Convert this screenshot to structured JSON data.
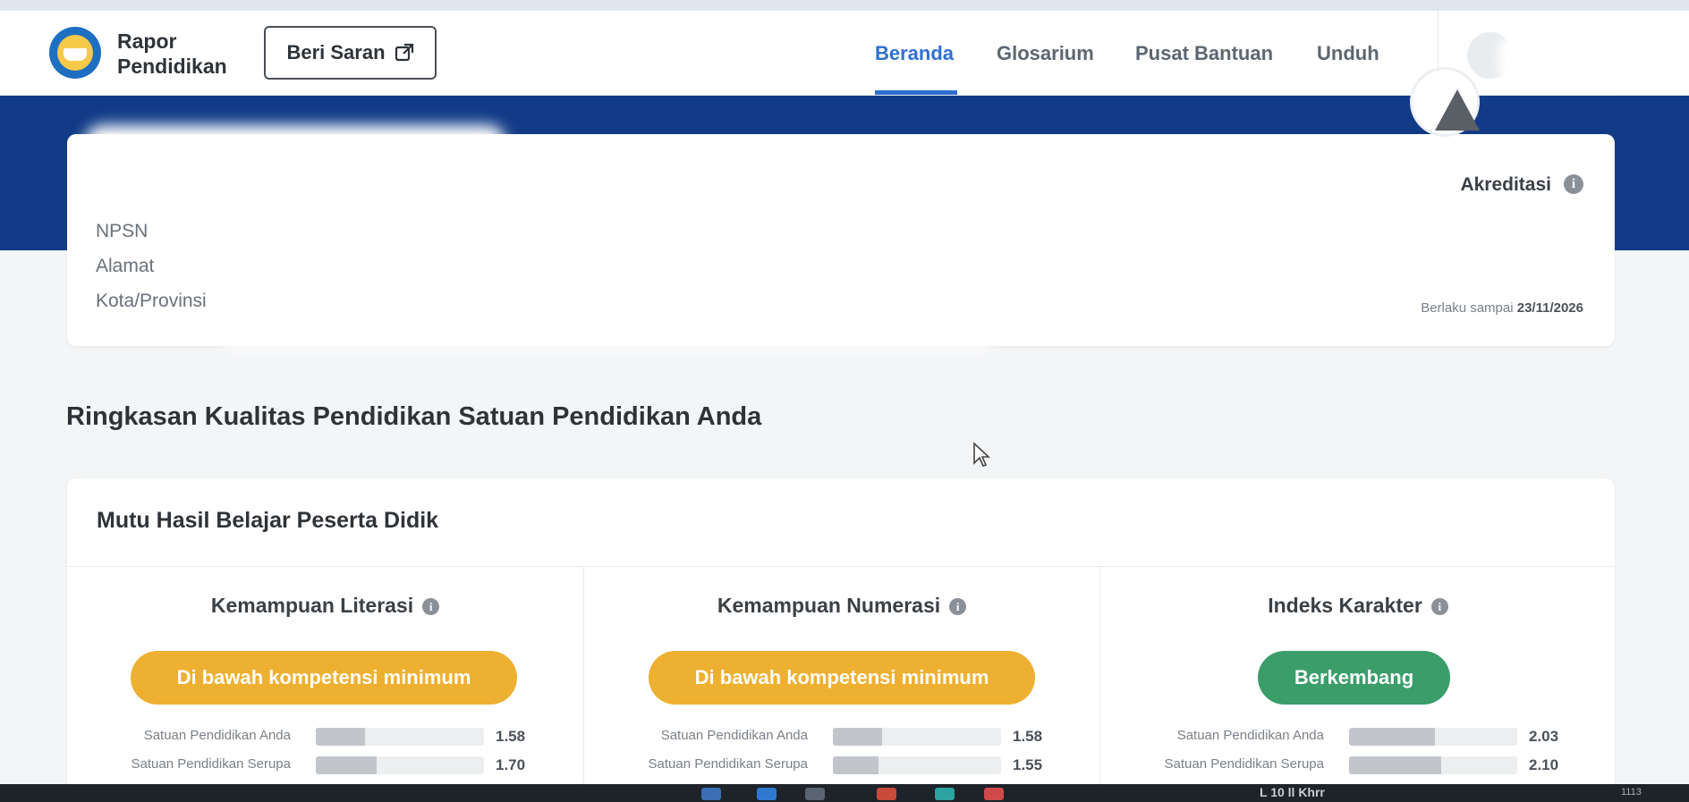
{
  "navbar": {
    "brand_line1": "Rapor",
    "brand_line2": "Pendidikan",
    "feedback_button": "Beri Saran",
    "items": [
      {
        "label": "Beranda",
        "active": true
      },
      {
        "label": "Glosarium",
        "active": false
      },
      {
        "label": "Pusat Bantuan",
        "active": false
      },
      {
        "label": "Unduh",
        "active": false
      }
    ],
    "accent_color": "#2f6fd1"
  },
  "school": {
    "labels": [
      "NPSN",
      "Alamat",
      "Kota/Provinsi"
    ],
    "accreditation_title": "Akreditasi",
    "valid_prefix": "Berlaku sampai",
    "valid_date": "23/11/2026"
  },
  "summary_title": "Ringkasan Kualitas Pendidikan Satuan Pendidikan Anda",
  "learning": {
    "title": "Mutu Hasil Belajar Peserta Didik",
    "columns": [
      {
        "title": "Kemampuan Literasi",
        "status": "Di bawah kompetensi minimum",
        "status_color": "#eeb030",
        "rows": [
          {
            "label": "Satuan Pendidikan Anda",
            "value": "1.58",
            "fill": 0.29
          },
          {
            "label": "Satuan Pendidikan Serupa",
            "value": "1.70",
            "fill": 0.36
          }
        ]
      },
      {
        "title": "Kemampuan Numerasi",
        "status": "Di bawah kompetensi minimum",
        "status_color": "#eeb030",
        "rows": [
          {
            "label": "Satuan Pendidikan Anda",
            "value": "1.58",
            "fill": 0.29
          },
          {
            "label": "Satuan Pendidikan Serupa",
            "value": "1.55",
            "fill": 0.27
          }
        ]
      },
      {
        "title": "Indeks Karakter",
        "status": "Berkembang",
        "status_color": "#3a9d6a",
        "rows": [
          {
            "label": "Satuan Pendidikan Anda",
            "value": "2.03",
            "fill": 0.51
          },
          {
            "label": "Satuan Pendidikan Serupa",
            "value": "2.10",
            "fill": 0.55
          }
        ]
      }
    ]
  },
  "taskbar": {
    "tray_text": "L 10 ll Khrr",
    "clock": "1113"
  }
}
